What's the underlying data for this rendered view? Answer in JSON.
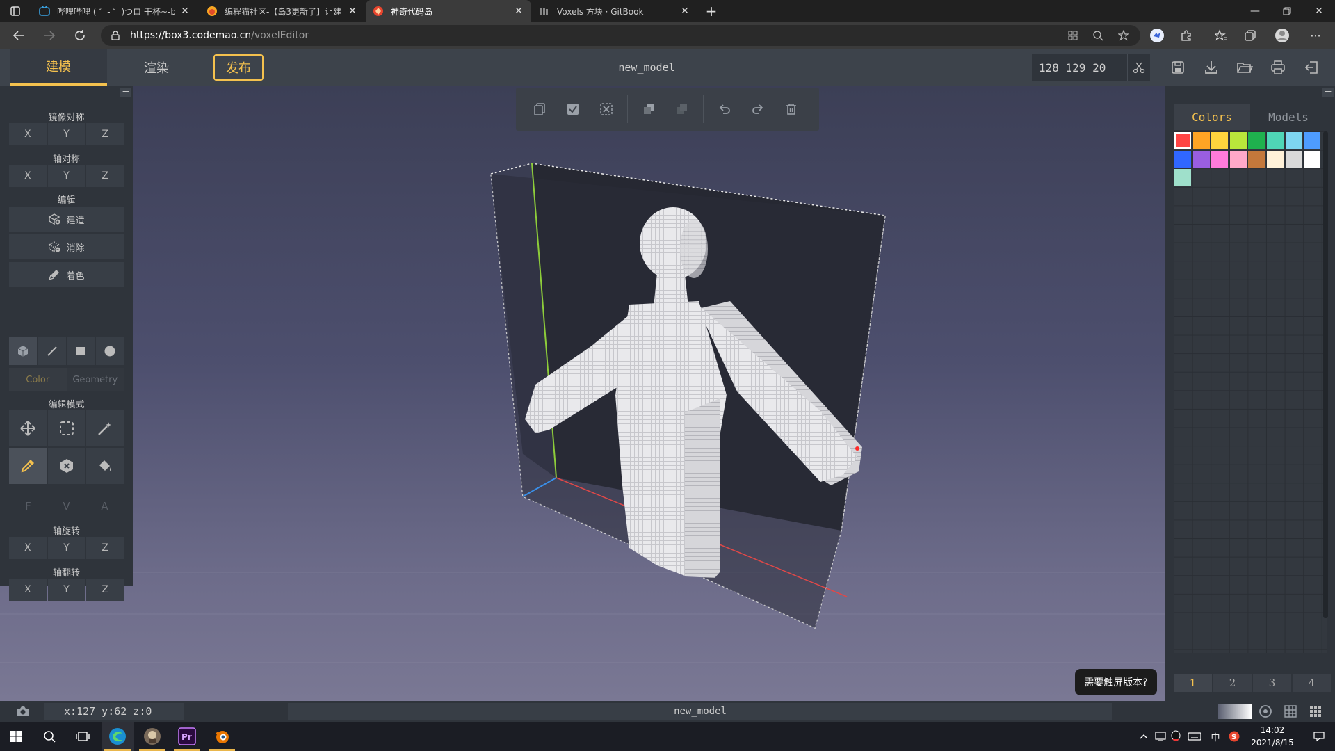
{
  "browser": {
    "tabs": [
      {
        "title": "哔哩哔哩 ( ゜- ゜)つロ 干杯~-bili",
        "active": false
      },
      {
        "title": "编程猫社区-【岛3更新了】让建",
        "active": false
      },
      {
        "title": "神奇代码岛",
        "active": true
      },
      {
        "title": "Voxels 方块 · GitBook",
        "active": false
      }
    ],
    "url_host": "https://box3.codemao.cn",
    "url_path": "/voxelEditor"
  },
  "app": {
    "tabs": {
      "build": "建模",
      "render": "渲染"
    },
    "publish": "发布",
    "model_name": "new_model",
    "dimensions": "128 129 20"
  },
  "left_panel": {
    "mirror_label": "镜像对称",
    "axis_sym_label": "轴对称",
    "edit_label": "编辑",
    "build": "建造",
    "erase": "消除",
    "paint": "着色",
    "color_tab": "Color",
    "geometry_tab": "Geometry",
    "edit_mode_label": "编辑模式",
    "fva": [
      "F",
      "V",
      "A"
    ],
    "rotate_label": "轴旋转",
    "flip_label": "轴翻转",
    "axes": [
      "X",
      "Y",
      "Z"
    ]
  },
  "right_panel": {
    "tabs": {
      "colors": "Colors",
      "models": "Models"
    },
    "swatches": [
      "#ff4444",
      "#ffa424",
      "#ffd43d",
      "#b9e63b",
      "#1fb14e",
      "#4fd6b6",
      "#7ed6f0",
      "#4e9cff",
      "#3067ff",
      "#9a5ee0",
      "#ff7bdb",
      "#ffa8c8",
      "#c4783b",
      "#fff1d8",
      "#d9d9d9",
      "#ffffff",
      "#9fe0cb"
    ],
    "selected_swatch": 0,
    "pages": [
      "1",
      "2",
      "3",
      "4"
    ]
  },
  "status": {
    "coords": "x:127 y:62 z:0",
    "model_name": "new_model",
    "tooltip": "需要触屏版本?"
  },
  "taskbar": {
    "time": "14:02",
    "date": "2021/8/15",
    "ime": "中"
  }
}
